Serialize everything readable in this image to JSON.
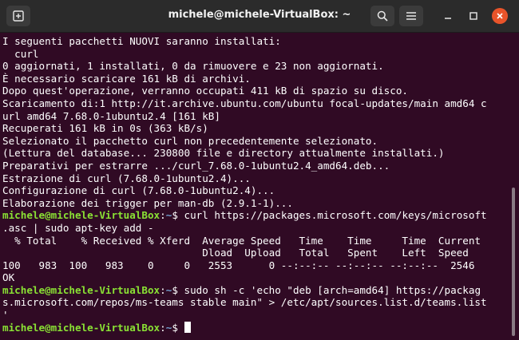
{
  "window": {
    "title": "michele@michele-VirtualBox: ~",
    "new_tab_icon": "new-tab-icon",
    "search_icon": "search-icon",
    "menu_icon": "hamburger-menu-icon",
    "close_icon": "close-icon"
  },
  "colors": {
    "background": "#300a24",
    "titlebar": "#2b2b2b",
    "prompt_user": "#8ae234",
    "prompt_path": "#729fcf",
    "close_button": "#e9542a"
  },
  "terminal": {
    "prompt": {
      "user_host": "michele@michele-VirtualBox",
      "separator": ":",
      "path": "~",
      "symbol": "$ "
    },
    "lines": [
      "I seguenti pacchetti NUOVI saranno installati:",
      "  curl",
      "0 aggiornati, 1 installati, 0 da rimuovere e 23 non aggiornati.",
      "È necessario scaricare 161 kB di archivi.",
      "Dopo quest'operazione, verranno occupati 411 kB di spazio su disco.",
      "Scaricamento di:1 http://it.archive.ubuntu.com/ubuntu focal-updates/main amd64 c",
      "url amd64 7.68.0-1ubuntu2.4 [161 kB]",
      "Recuperati 161 kB in 0s (363 kB/s)",
      "Selezionato il pacchetto curl non precedentemente selezionato.",
      "(Lettura del database... 230800 file e directory attualmente installati.)",
      "Preparativi per estrarre .../curl_7.68.0-1ubuntu2.4_amd64.deb...",
      "Estrazione di curl (7.68.0-1ubuntu2.4)...",
      "Configurazione di curl (7.68.0-1ubuntu2.4)...",
      "Elaborazione dei trigger per man-db (2.9.1-1)..."
    ],
    "command1": "curl https://packages.microsoft.com/keys/microsoft",
    "command1_cont": ".asc | sudo apt-key add -",
    "curl_header1": "  % Total    % Received % Xferd  Average Speed   Time    Time     Time  Current",
    "curl_header2": "                                 Dload  Upload   Total   Spent    Left  Speed",
    "curl_progress": "100   983  100   983    0     0   2553      0 --:--:-- --:--:-- --:--:--  2546",
    "ok_line": "OK",
    "command2": "sudo sh -c 'echo \"deb [arch=amd64] https://packag",
    "command2_cont1": "s.microsoft.com/repos/ms-teams stable main\" > /etc/apt/sources.list.d/teams.list",
    "command2_cont2": "'"
  }
}
